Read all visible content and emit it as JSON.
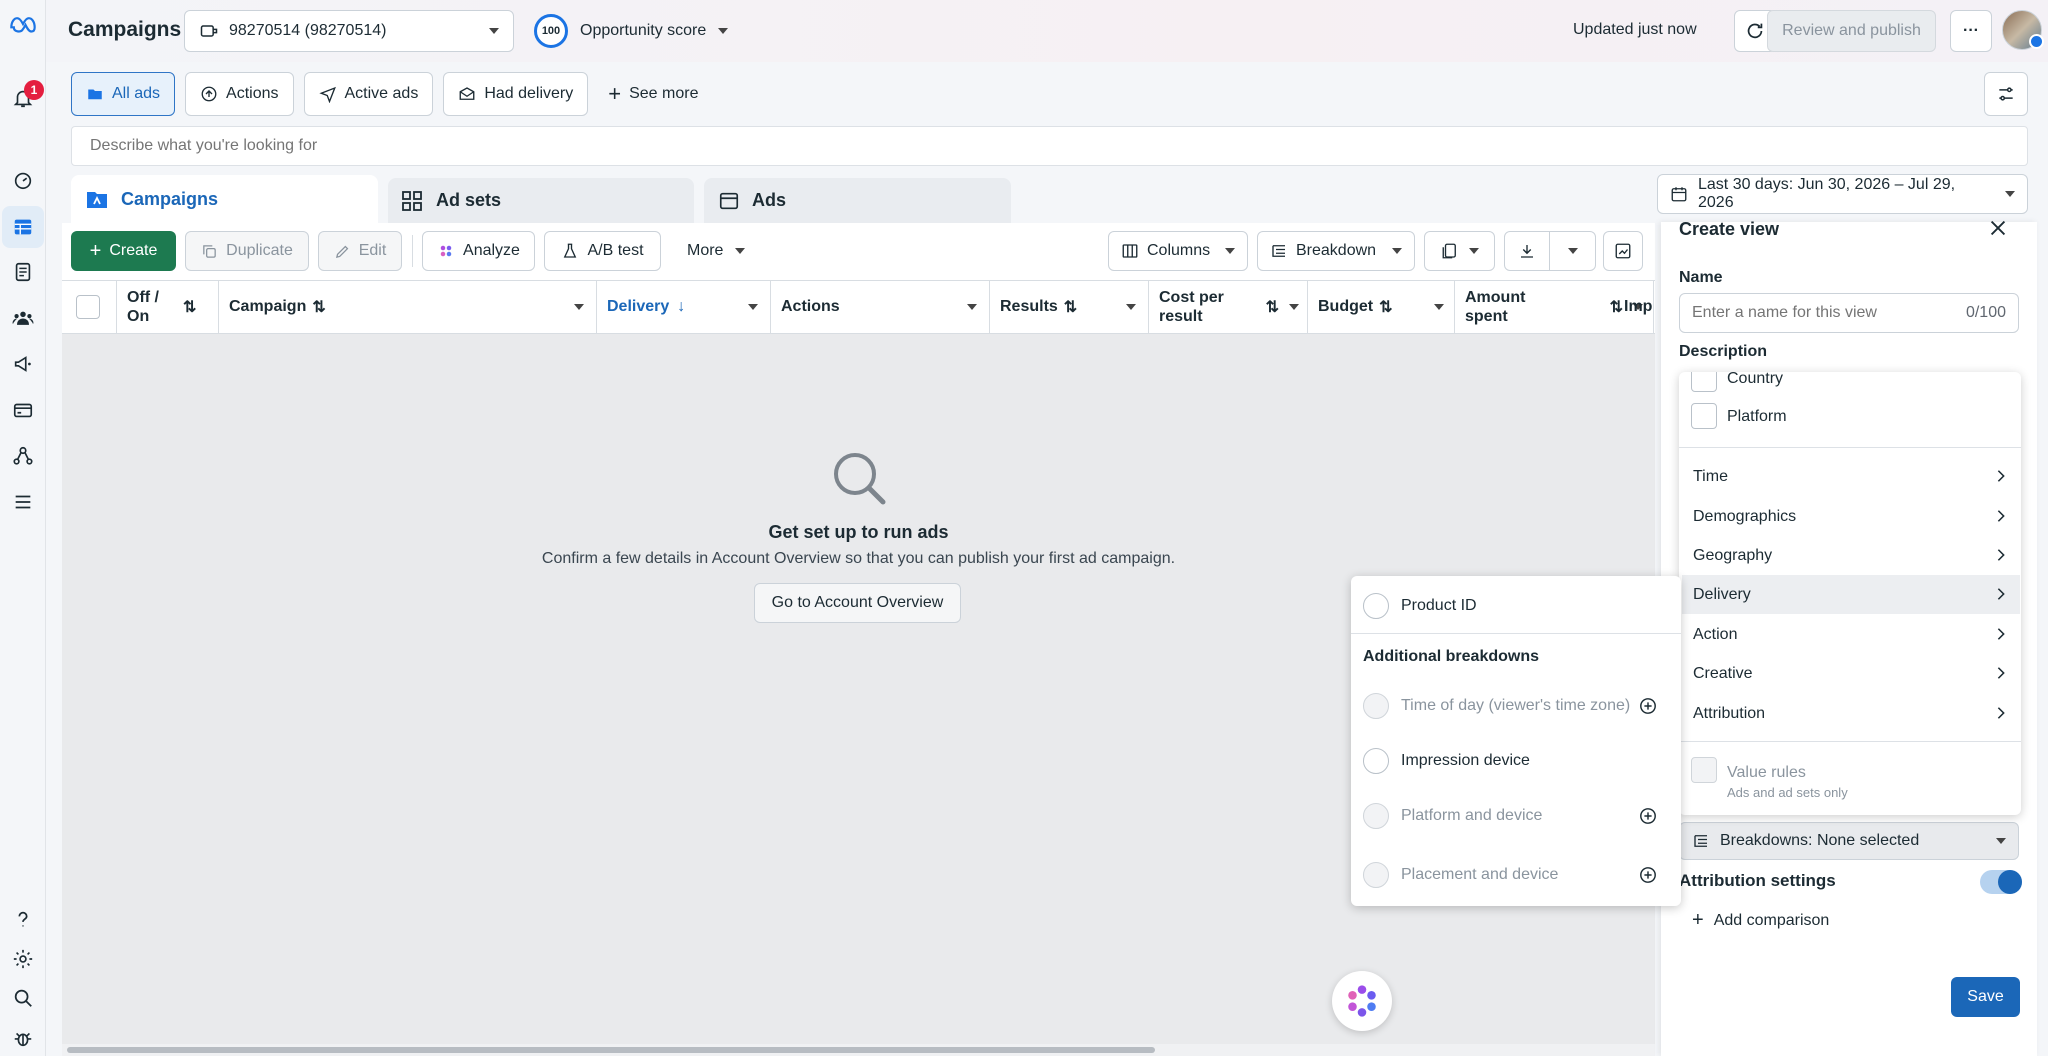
{
  "topbar": {
    "title": "Campaigns",
    "account": "98270514 (98270514)",
    "score_value": "100",
    "score_label": "Opportunity score",
    "updated": "Updated just now",
    "review_publish": "Review and publish",
    "more": "···"
  },
  "rail": {
    "notification_count": "1"
  },
  "filters": {
    "items": [
      "All ads",
      "Actions",
      "Active ads",
      "Had delivery"
    ],
    "see_more": "See more",
    "search_placeholder": "Describe what you're looking for"
  },
  "tabs": {
    "campaigns": "Campaigns",
    "adsets": "Ad sets",
    "ads": "Ads"
  },
  "daterange": "Last 30 days: Jun 30, 2026 – Jul 29, 2026",
  "toolbar": {
    "create": "Create",
    "duplicate": "Duplicate",
    "edit": "Edit",
    "analyze": "Analyze",
    "abtest": "A/B test",
    "more": "More",
    "columns": "Columns",
    "breakdown": "Breakdown"
  },
  "table": {
    "headers": [
      "Off / On",
      "Campaign",
      "Delivery",
      "Actions",
      "Results",
      "Cost per result",
      "Budget",
      "Amount spent",
      "Imp"
    ]
  },
  "empty": {
    "title": "Get set up to run ads",
    "message": "Confirm a few details in Account Overview so that you can publish your first ad campaign.",
    "button": "Go to Account Overview"
  },
  "create_view": {
    "title": "Create view",
    "name_label": "Name",
    "name_placeholder": "Enter a name for this view",
    "name_count": "0/100",
    "description_label": "Description",
    "breakdowns": "Breakdowns: None selected",
    "attribution": "Attribution settings",
    "add_comparison": "Add comparison",
    "save": "Save"
  },
  "breakdown_menu": {
    "country": "Country",
    "platform": "Platform",
    "categories": [
      "Time",
      "Demographics",
      "Geography",
      "Delivery",
      "Action",
      "Creative",
      "Attribution"
    ],
    "value_rules": "Value rules",
    "value_rules_sub": "Ads and ad sets only"
  },
  "delivery_submenu": {
    "product_id": "Product ID",
    "additional_heading": "Additional breakdowns",
    "items": [
      "Time of day (viewer's time zone)",
      "Impression device",
      "Platform and device",
      "Placement and device"
    ]
  },
  "colors": {
    "accent": "#1b74e4",
    "create_green": "#1d7a50",
    "save_blue": "#1b67b8",
    "badge_red": "#e41e3f"
  }
}
